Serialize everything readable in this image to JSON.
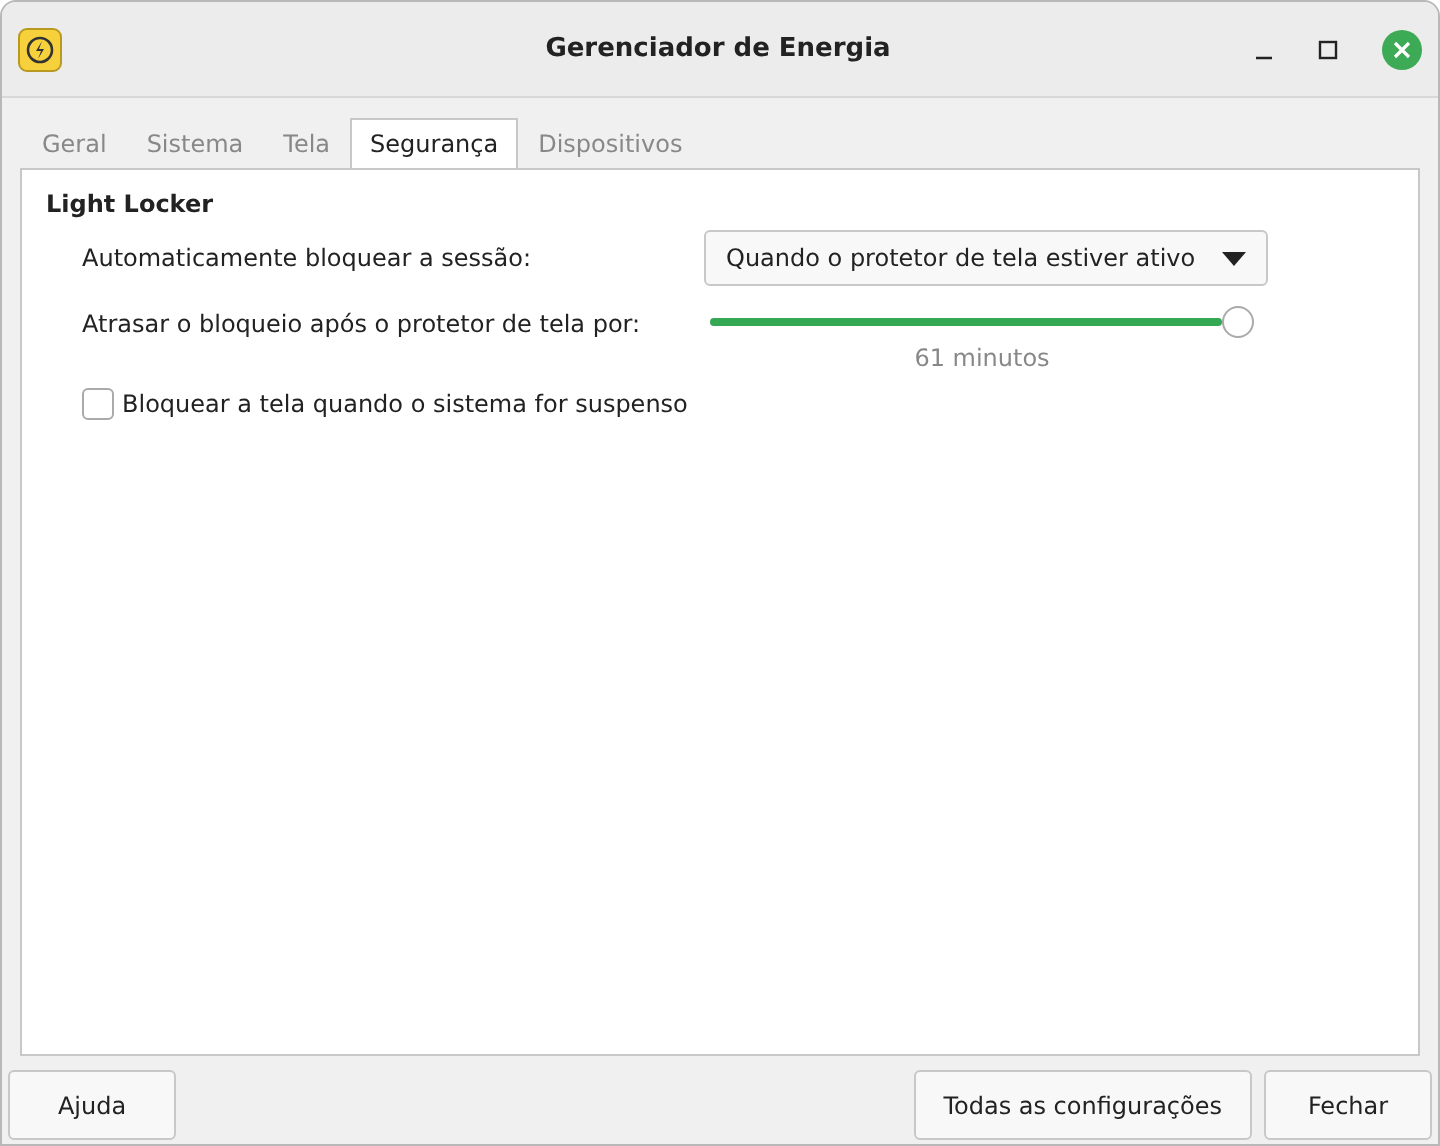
{
  "window": {
    "title": "Gerenciador de Energia"
  },
  "tabs": [
    {
      "label": "Geral",
      "selected": false
    },
    {
      "label": "Sistema",
      "selected": false
    },
    {
      "label": "Tela",
      "selected": false
    },
    {
      "label": "Segurança",
      "selected": true
    },
    {
      "label": "Dispositivos",
      "selected": false
    }
  ],
  "section": {
    "title": "Light Locker",
    "lock_session": {
      "label": "Automaticamente bloquear a sessão:",
      "value": "Quando o protetor de tela estiver ativo"
    },
    "delay": {
      "label": "Atrasar o bloqueio após o protetor de tela por:",
      "level": 1,
      "reading": "61 minutos"
    },
    "lock_on_suspend": {
      "label": "Bloquear a tela quando o sistema for suspenso",
      "checked": false
    }
  },
  "buttons": {
    "help": "Ajuda",
    "all_settings": "Todas as configurações",
    "close": "Fechar"
  }
}
